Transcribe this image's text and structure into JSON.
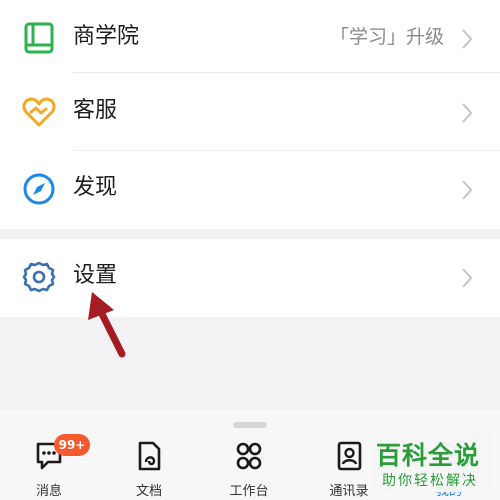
{
  "menu": {
    "business_school": {
      "label": "商学院",
      "value": "「学习」升级",
      "icon": "book-icon",
      "color": "#2bb24c"
    },
    "customer_service": {
      "label": "客服",
      "icon": "heart-service-icon",
      "color": "#f5a623"
    },
    "discover": {
      "label": "发现",
      "icon": "compass-icon",
      "color": "#1e88e5"
    },
    "settings": {
      "label": "设置",
      "icon": "gear-icon",
      "color": "#3a6fb0"
    }
  },
  "tabbar": {
    "tabs": [
      {
        "label": "消息",
        "icon": "message-icon",
        "badge": "99+"
      },
      {
        "label": "文档",
        "icon": "document-icon"
      },
      {
        "label": "工作台",
        "icon": "workspace-icon"
      },
      {
        "label": "通讯录",
        "icon": "contacts-icon"
      },
      {
        "label": "我的",
        "icon": "profile-icon"
      }
    ]
  },
  "watermark": {
    "title": "百科全说",
    "subtitle": "助你轻松解决"
  },
  "colors": {
    "badge": "#f35b2f",
    "arrow": "#a51d22",
    "watermark": "#2a9d3a"
  }
}
